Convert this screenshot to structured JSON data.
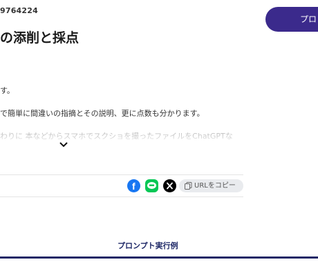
{
  "header": {
    "id_text": "9764224",
    "cta_label": "プロ"
  },
  "title": "の添削と採点",
  "description": {
    "line1": "す。",
    "line2": "で簡単に間違いの指摘とその説明、更に点数も分かります。",
    "line3": "わりに 本などからスマホでスクショを撮ったファイルをChatGPTな"
  },
  "share": {
    "icons": [
      "facebook-icon",
      "line-icon",
      "x-icon"
    ],
    "copy_label": "URLをコピー"
  },
  "footer": {
    "exec_example_label": "プロンプト実行例"
  },
  "colors": {
    "cta": "#3b2a8c",
    "accent_navy": "#1d2766",
    "facebook": "#1877f2",
    "line": "#06c755"
  }
}
